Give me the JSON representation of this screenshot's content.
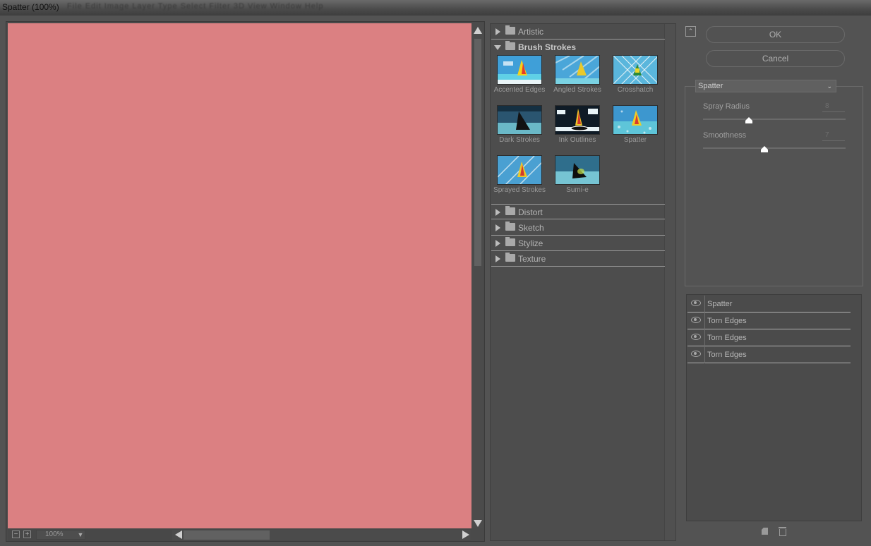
{
  "window": {
    "title": "Spatter (100%)",
    "ghost_menu": "File  Edit  Image  Layer  Type  Select  Filter  3D  View  Window  Help"
  },
  "preview": {
    "canvas_color": "#db8082",
    "zoom_value": "100%",
    "zoom_out_glyph": "−",
    "zoom_in_glyph": "+"
  },
  "gallery": {
    "categories_top": [
      {
        "label": "Artistic",
        "expanded": false
      },
      {
        "label": "Brush Strokes",
        "expanded": true
      }
    ],
    "thumbnails": [
      {
        "label": "Accented Edges",
        "icon": "accented-edges-thumb"
      },
      {
        "label": "Angled Strokes",
        "icon": "angled-strokes-thumb"
      },
      {
        "label": "Crosshatch",
        "icon": "crosshatch-thumb"
      },
      {
        "label": "Dark Strokes",
        "icon": "dark-strokes-thumb"
      },
      {
        "label": "Ink Outlines",
        "icon": "ink-outlines-thumb"
      },
      {
        "label": "Spatter",
        "icon": "spatter-thumb"
      },
      {
        "label": "Sprayed Strokes",
        "icon": "sprayed-strokes-thumb"
      },
      {
        "label": "Sumi-e",
        "icon": "sumi-e-thumb"
      }
    ],
    "categories_bottom": [
      {
        "label": "Distort",
        "expanded": false
      },
      {
        "label": "Sketch",
        "expanded": false
      },
      {
        "label": "Stylize",
        "expanded": false
      },
      {
        "label": "Texture",
        "expanded": false
      }
    ]
  },
  "actions": {
    "ok_label": "OK",
    "cancel_label": "Cancel"
  },
  "settings": {
    "filter_select": "Spatter",
    "params": [
      {
        "label": "Spray Radius",
        "value": "8",
        "level": 0.32
      },
      {
        "label": "Smoothness",
        "value": "7",
        "level": 0.43
      }
    ]
  },
  "effect_layers": [
    {
      "name": "Spatter"
    },
    {
      "name": "Torn Edges"
    },
    {
      "name": "Torn Edges"
    },
    {
      "name": "Torn Edges"
    }
  ]
}
